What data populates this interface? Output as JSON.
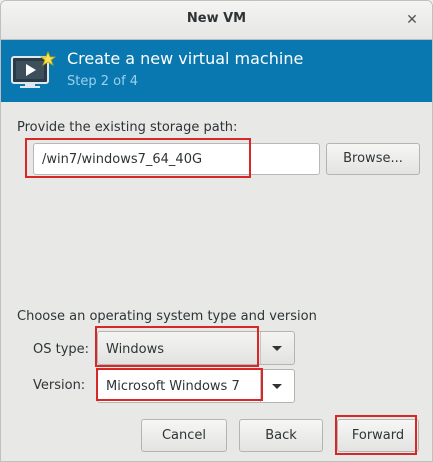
{
  "window": {
    "title": "New VM",
    "close_glyph": "✕"
  },
  "header": {
    "icon": "virtual-machine-icon",
    "title": "Create a new virtual machine",
    "step": "Step 2 of 4"
  },
  "storage": {
    "label": "Provide the existing storage path:",
    "path_value": "/win7/windows7_64_40G",
    "browse_label": "Browse..."
  },
  "os": {
    "section_label": "Choose an operating system type and version",
    "type_label": "OS type:",
    "type_value": "Windows",
    "version_label": "Version:",
    "version_value": "Microsoft Windows 7"
  },
  "footer": {
    "cancel_label": "Cancel",
    "back_label": "Back",
    "forward_label": "Forward"
  },
  "colors": {
    "banner": "#0a78b0",
    "highlight": "#d62828"
  }
}
